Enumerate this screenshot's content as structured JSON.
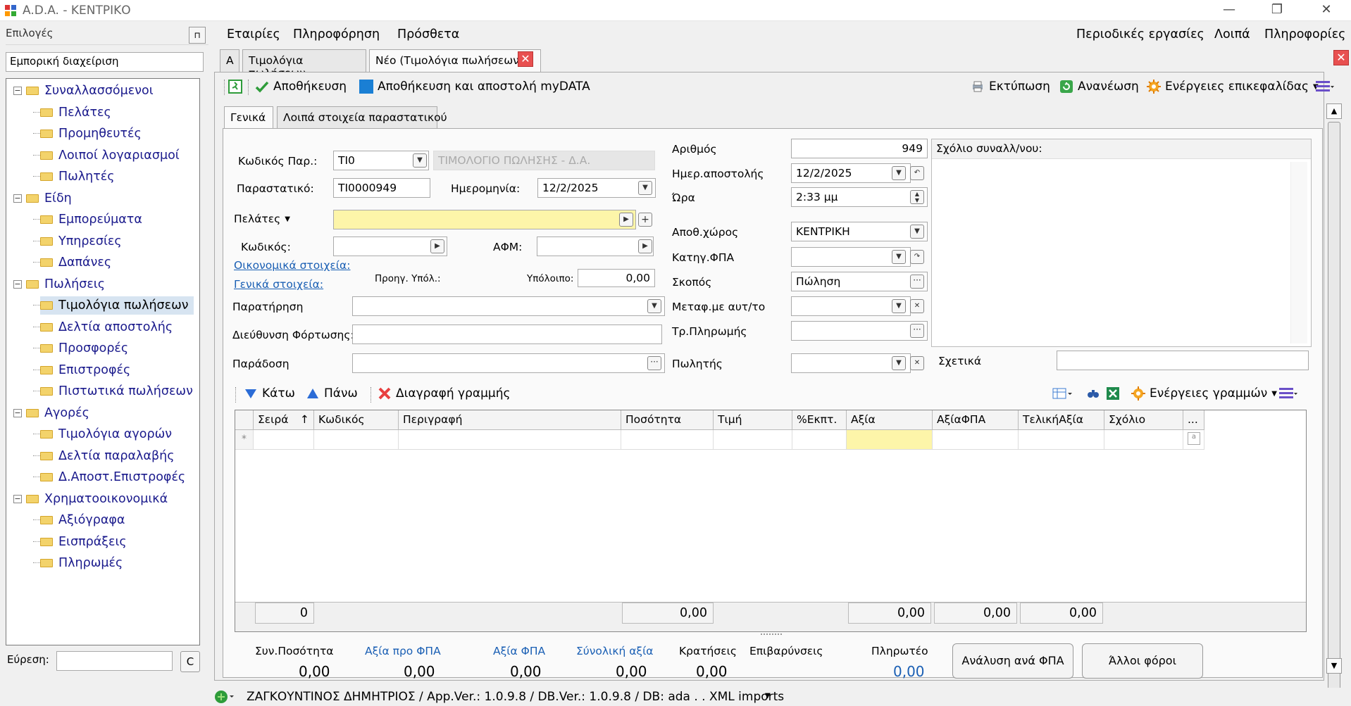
{
  "window": {
    "title": "A.D.A. - ΚΕΝΤΡΙΚΟ",
    "min": "—",
    "max": "❐",
    "close": "✕"
  },
  "left": {
    "header": "Επιλογές",
    "pin": "⊓",
    "module": "Εμπορική διαχείριση",
    "tree": [
      {
        "label": "Συναλλασσόμενοι",
        "level": 0,
        "exp": "−"
      },
      {
        "label": "Πελάτες",
        "level": 1
      },
      {
        "label": "Προμηθευτές",
        "level": 1
      },
      {
        "label": "Λοιποί λογαριασμοί",
        "level": 1
      },
      {
        "label": "Πωλητές",
        "level": 1
      },
      {
        "label": "Είδη",
        "level": 0,
        "exp": "−"
      },
      {
        "label": "Εμπορεύματα",
        "level": 1
      },
      {
        "label": "Υπηρεσίες",
        "level": 1
      },
      {
        "label": "Δαπάνες",
        "level": 1
      },
      {
        "label": "Πωλήσεις",
        "level": 0,
        "exp": "−"
      },
      {
        "label": "Τιμολόγια πωλήσεων",
        "level": 1,
        "selected": true
      },
      {
        "label": "Δελτία αποστολής",
        "level": 1
      },
      {
        "label": "Προσφορές",
        "level": 1
      },
      {
        "label": "Επιστροφές",
        "level": 1
      },
      {
        "label": "Πιστωτικά πωλήσεων",
        "level": 1
      },
      {
        "label": "Αγορές",
        "level": 0,
        "exp": "−"
      },
      {
        "label": "Τιμολόγια αγορών",
        "level": 1
      },
      {
        "label": "Δελτία παραλαβής",
        "level": 1
      },
      {
        "label": "Δ.Αποστ.Επιστροφές",
        "level": 1
      },
      {
        "label": "Χρηματοοικονομικά",
        "level": 0,
        "exp": "−"
      },
      {
        "label": "Αξιόγραφα",
        "level": 1
      },
      {
        "label": "Εισπράξεις",
        "level": 1
      },
      {
        "label": "Πληρωμές",
        "level": 1
      }
    ],
    "find_label": "Εύρεση:",
    "find_value": "",
    "clear": "C"
  },
  "menu": {
    "left": [
      "Εταιρίες",
      "Πληροφόρηση",
      "Πρόσθετα"
    ],
    "right": [
      "Περιοδικές εργασίες",
      "Λοιπά",
      "Πληροφορίες"
    ]
  },
  "tabs": {
    "t0": "A",
    "t1": "Τιμολόγια πωλήσεων",
    "t2": "Νέο (Τιμολόγια πωλήσεων)",
    "close": "✕"
  },
  "toolbar": {
    "save": "Αποθήκευση",
    "save_send": "Αποθήκευση και αποστολή myDATA",
    "print": "Εκτύπωση",
    "refresh": "Ανανέωση",
    "header_actions": "Ενέργειες επικεφαλίδας"
  },
  "subtabs": {
    "general": "Γενικά",
    "other": "Λοιπά στοιχεία παραστατικού"
  },
  "form": {
    "doc_code_lbl": "Κωδικός Παρ.:",
    "doc_code": "ΤΙ0",
    "doc_type_desc": "ΤΙΜΟΛΟΓΙΟ ΠΩΛΗΣΗΣ - Δ.Α.",
    "doc_lbl": "Παραστατικό:",
    "doc": "ΤΙ0000949",
    "date_lbl": "Ημερομηνία:",
    "date": "12/2/2025",
    "customers_btn": "Πελάτες",
    "customer_value": "",
    "code_lbl": "Κωδικός:",
    "afm_lbl": "ΑΦΜ:",
    "econ_link": "Οικονομικά στοιχεία:",
    "general_link": "Γενικά στοιχεία:",
    "prev_bal_lbl": "Προηγ. Υπόλ.:",
    "bal_lbl": "Υπόλοιπο:",
    "bal": "0,00",
    "remark_lbl": "Παρατήρηση",
    "load_addr_lbl": "Διεύθυνση Φόρτωσης:",
    "delivery_lbl": "Παράδοση",
    "number_lbl": "Αριθμός",
    "number": "949",
    "ship_date_lbl": "Ημερ.αποστολής",
    "ship_date": "12/2/2025",
    "time_lbl": "Ώρα",
    "time": "2:33 μμ",
    "warehouse_lbl": "Αποθ.χώρος",
    "warehouse": "ΚΕΝΤΡΙΚΗ",
    "vat_cat_lbl": "Κατηγ.ΦΠΑ",
    "purpose_lbl": "Σκοπός",
    "purpose": "Πώληση",
    "transport_lbl": "Μεταφ.με αυτ/το",
    "payment_lbl": "Τρ.Πληρωμής",
    "seller_lbl": "Πωλητής",
    "comment_lbl": "Σχόλιο συναλλ/νου:",
    "related_lbl": "Σχετικά"
  },
  "lines_toolbar": {
    "down": "Κάτω",
    "up": "Πάνω",
    "delete": "Διαγραφή γραμμής",
    "actions": "Ενέργειες γραμμών"
  },
  "grid": {
    "columns": [
      "Σειρά",
      "Κωδικός",
      "Περιγραφή",
      "Ποσότητα",
      "Τιμή",
      "%Εκπτ.",
      "Αξία",
      "ΑξίαΦΠΑ",
      "ΤελικήΑξία",
      "Σχόλιο",
      "..."
    ],
    "newrow": "*",
    "sort": "↑"
  },
  "sums": {
    "count": "0",
    "qty": "0,00",
    "value": "0,00",
    "vat": "0,00",
    "final": "0,00"
  },
  "totals": {
    "labels": [
      "Συν.Ποσότητα",
      "Αξία προ ΦΠΑ",
      "Αξία ΦΠΑ",
      "Σύνολική αξία",
      "Κρατήσεις",
      "Επιβαρύνσεις",
      "Πληρωτέο"
    ],
    "values": [
      "0,00",
      "0,00",
      "0,00",
      "0,00",
      "0,00",
      "",
      "0,00"
    ],
    "vat_analysis": "Ανάλυση ανά ΦΠΑ",
    "other_taxes": "Άλλοι φόροι"
  },
  "status": {
    "text": "ΖΑΓΚΟΥΝΤΙΝΟΣ ΔΗΜΗΤΡΙΟΣ / App.Ver.: 1.0.9.8 / DB.Ver.: 1.0.9.8 / DB: ada  .  .  XML imports"
  },
  "colors": {
    "accent_blue": "#1a5fb4",
    "link_blue": "#1a5fb4",
    "customer_yellow": "#fdf5a9",
    "save_green": "#2e9c3a",
    "delete_red": "#e84040"
  }
}
